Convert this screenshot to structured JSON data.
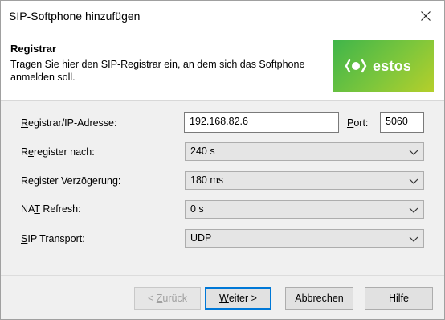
{
  "window": {
    "title": "SIP-Softphone hinzufügen"
  },
  "header": {
    "title": "Registrar",
    "subtitle": "Tragen Sie hier den SIP-Registrar ein, an dem sich das Softphone anmelden soll.",
    "logo_text": "estos"
  },
  "form": {
    "registrar": {
      "label_u": "R",
      "label_rest": "egistrar/IP-Adresse:",
      "value": "192.168.82.6"
    },
    "port": {
      "label_u": "P",
      "label_rest": "ort:",
      "value": "5060"
    },
    "reregister": {
      "label_pre": "R",
      "label_u": "e",
      "label_rest": "register nach:",
      "value": "240 s"
    },
    "delay": {
      "label": "Register Verzögerung:",
      "value": "180 ms"
    },
    "nat": {
      "label_pre": "NA",
      "label_u": "T",
      "label_rest": " Refresh:",
      "value": "0 s"
    },
    "transport": {
      "label_u": "S",
      "label_rest": "IP Transport:",
      "value": "UDP"
    }
  },
  "buttons": {
    "back_pre": "< ",
    "back_u": "Z",
    "back_rest": "urück",
    "next_u": "W",
    "next_rest": "eiter >",
    "cancel": "Abbrechen",
    "help": "Hilfe"
  },
  "colors": {
    "accent": "#0078d7",
    "logo_green": "#5cbf42"
  }
}
